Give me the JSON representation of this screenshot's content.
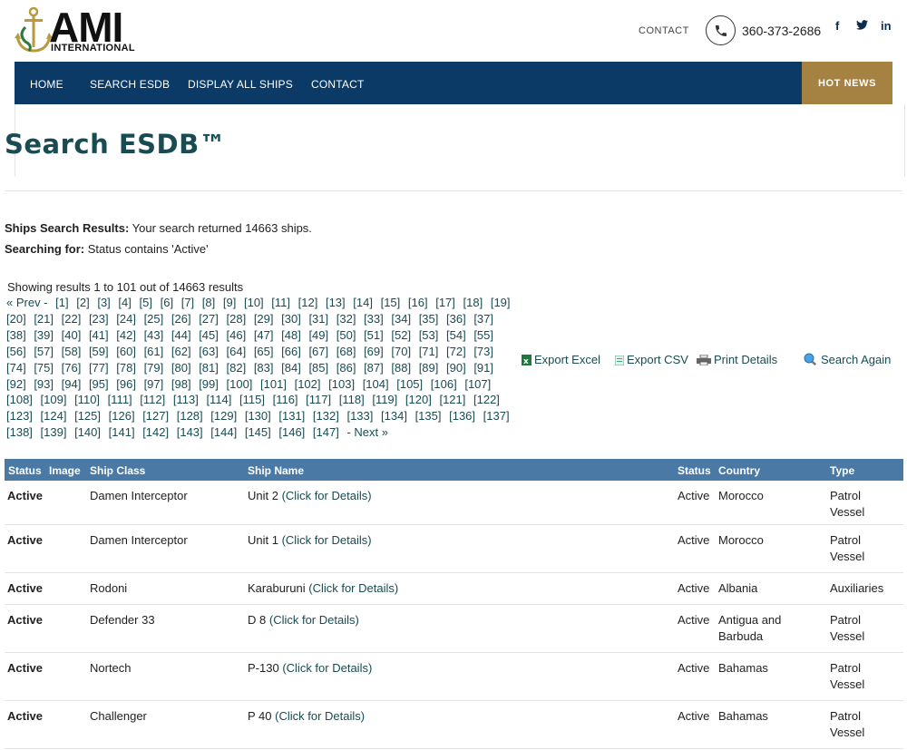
{
  "header": {
    "logo_text": "AMI",
    "logo_sub": "INTERNATIONAL",
    "contact_label": "CONTACT",
    "phone": "360-373-2686",
    "social": [
      "f",
      "t",
      "in"
    ]
  },
  "nav": {
    "items": [
      "HOME",
      "SEARCH ESDB",
      "DISPLAY ALL SHIPS",
      "CONTACT"
    ],
    "hot_news": "HOT NEWS"
  },
  "page": {
    "title": "Search ESDB™"
  },
  "results": {
    "label1": "Ships Search Results:",
    "text1": " Your search returned 14663 ships.",
    "label2": "Searching for:",
    "text2": " Status contains 'Active'",
    "showing": "Showing results 1 to 101 out of 14663 results",
    "prev": "« Prev -",
    "next": "- Next »",
    "page_count": 147
  },
  "tools": {
    "excel": "Export Excel",
    "csv": "Export CSV",
    "print": "Print Details",
    "search_again": "Search Again"
  },
  "table": {
    "headers": {
      "status": "Status",
      "image": "Image",
      "ship_class": "Ship Class",
      "ship_name": "Ship Name",
      "status2": "Status",
      "country": "Country",
      "type": "Type"
    },
    "details_link": "(Click for Details)",
    "rows": [
      {
        "status": "Active",
        "ship_class": "Damen Interceptor",
        "ship_name": "Unit 2",
        "status2": "Active",
        "country": "Morocco",
        "type": "Patrol Vessel"
      },
      {
        "status": "Active",
        "ship_class": "Damen Interceptor",
        "ship_name": "Unit 1",
        "status2": "Active",
        "country": "Morocco",
        "type": "Patrol Vessel"
      },
      {
        "status": "Active",
        "ship_class": "Rodoni",
        "ship_name": "Karaburuni",
        "status2": "Active",
        "country": "Albania",
        "type": "Auxiliaries"
      },
      {
        "status": "Active",
        "ship_class": "Defender 33",
        "ship_name": "D 8",
        "status2": "Active",
        "country": "Antigua and Barbuda",
        "type": "Patrol Vessel"
      },
      {
        "status": "Active",
        "ship_class": "Nortech",
        "ship_name": "P-130",
        "status2": "Active",
        "country": "Bahamas",
        "type": "Patrol Vessel"
      },
      {
        "status": "Active",
        "ship_class": "Challenger",
        "ship_name": "P 40",
        "status2": "Active",
        "country": "Bahamas",
        "type": "Patrol Vessel"
      }
    ]
  }
}
